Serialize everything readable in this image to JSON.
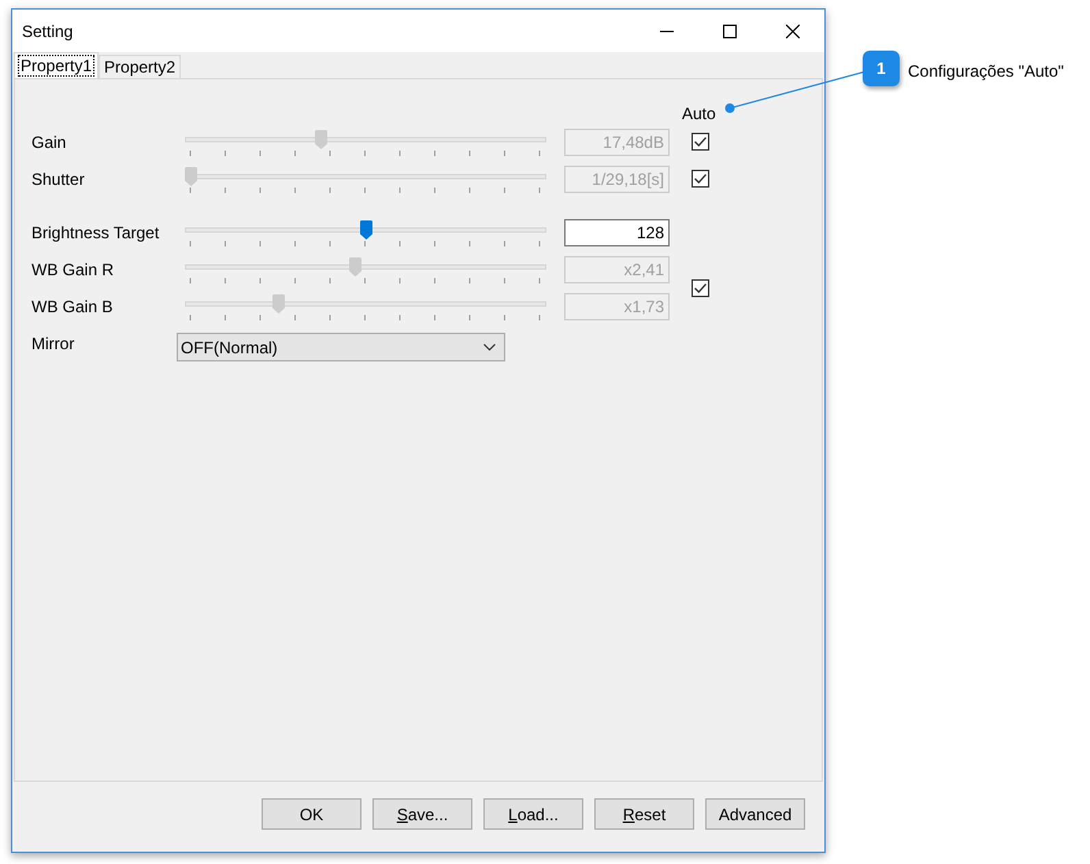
{
  "window": {
    "title": "Setting"
  },
  "tabs": [
    {
      "label": "Property1",
      "selected": true
    },
    {
      "label": "Property2",
      "selected": false
    }
  ],
  "auto_header": "Auto",
  "groups": [
    {
      "rows": [
        {
          "label": "Gain",
          "level": 0.37,
          "value": "17,48dB",
          "disabled": true
        }
      ],
      "auto": {
        "checked": true
      }
    },
    {
      "rows": [
        {
          "label": "Shutter",
          "level": 0.0,
          "value": "1/29,18[s]",
          "disabled": true
        }
      ],
      "auto": {
        "checked": true
      }
    },
    {
      "rows": [
        {
          "label": "Brightness Target",
          "level": 0.5,
          "value": "128",
          "disabled": false
        }
      ]
    },
    {
      "rows": [
        {
          "label": "WB Gain R",
          "level": 0.47,
          "value": "x2,41",
          "disabled": true
        },
        {
          "label": "WB Gain B",
          "level": 0.25,
          "value": "x1,73",
          "disabled": true
        }
      ],
      "auto": {
        "checked": true
      }
    }
  ],
  "mirror": {
    "label": "Mirror",
    "value": "OFF(Normal)"
  },
  "buttons": [
    {
      "label": "OK",
      "mnemonic": false
    },
    {
      "label": "Save...",
      "mnemonic": true
    },
    {
      "label": "Load...",
      "mnemonic": true
    },
    {
      "label": "Reset",
      "mnemonic": true
    },
    {
      "label": "Advanced",
      "mnemonic": false
    }
  ],
  "callout": {
    "number": "1",
    "text": "Configurações \"Auto\""
  }
}
